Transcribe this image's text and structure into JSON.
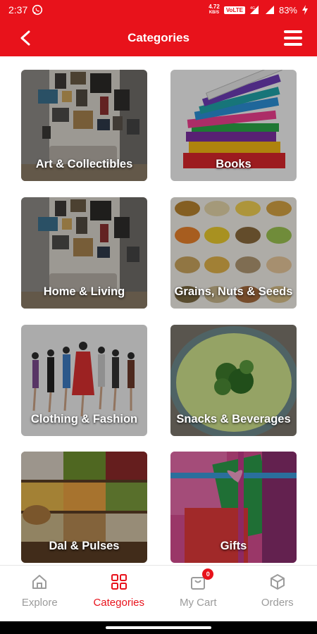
{
  "status_bar": {
    "time": "2:37",
    "speed": "4.72",
    "speed_unit": "KB/S",
    "volte": "VoLTE",
    "network": "4G",
    "battery": "83%"
  },
  "app_bar": {
    "title": "Categories"
  },
  "categories": [
    {
      "label": "Art & Collectibles"
    },
    {
      "label": "Books"
    },
    {
      "label": "Home & Living"
    },
    {
      "label": "Grains, Nuts & Seeds"
    },
    {
      "label": "Clothing & Fashion"
    },
    {
      "label": "Snacks & Beverages"
    },
    {
      "label": "Dal & Pulses"
    },
    {
      "label": "Gifts"
    }
  ],
  "bottom_nav": {
    "explore": "Explore",
    "categories": "Categories",
    "cart": "My Cart",
    "cart_badge": "0",
    "orders": "Orders"
  },
  "colors": {
    "brand": "#e8121b",
    "inactive": "#9b9b9b"
  }
}
